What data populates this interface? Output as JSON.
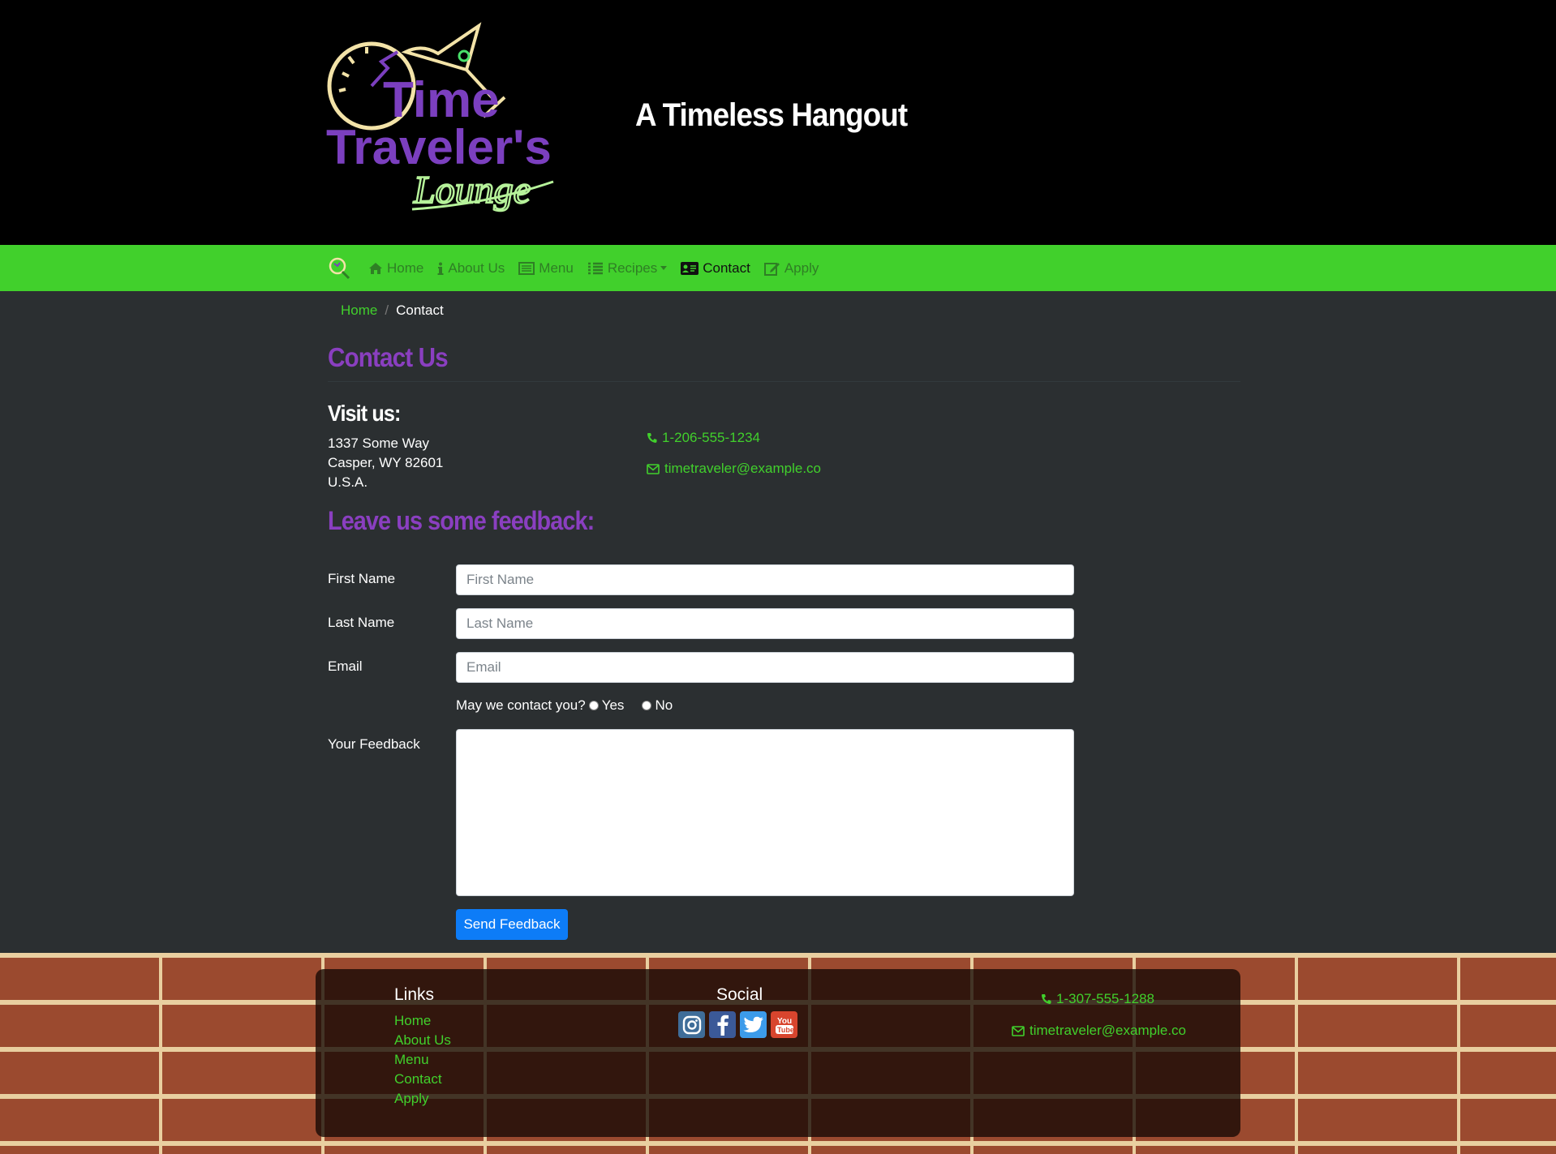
{
  "header": {
    "logo_text": "Time Traveler's Lounge",
    "tagline": "A Timeless Hangout"
  },
  "nav": {
    "items": [
      {
        "label": "Home",
        "icon": "home-icon"
      },
      {
        "label": "About Us",
        "icon": "info-icon"
      },
      {
        "label": "Menu",
        "icon": "list-alt-icon"
      },
      {
        "label": "Recipes",
        "icon": "list-icon"
      },
      {
        "label": "Contact",
        "icon": "address-card-icon"
      },
      {
        "label": "Apply",
        "icon": "edit-icon"
      }
    ],
    "active": "Contact"
  },
  "breadcrumb": {
    "home": "Home",
    "separator": "/",
    "current": "Contact"
  },
  "page": {
    "title": "Contact Us",
    "visit_heading": "Visit us:",
    "address": [
      "1337 Some Way",
      "Casper, WY 82601",
      "U.S.A."
    ],
    "phone": "1-206-555-1234",
    "email": "timetraveler@example.co",
    "feedback_heading": "Leave us some feedback:"
  },
  "form": {
    "first_name_label": "First Name",
    "first_name_placeholder": "First Name",
    "last_name_label": "Last Name",
    "last_name_placeholder": "Last Name",
    "email_label": "Email",
    "email_placeholder": "Email",
    "contact_question": "May we contact you?",
    "yes_label": "Yes",
    "no_label": "No",
    "feedback_label": "Your Feedback",
    "submit_label": "Send Feedback"
  },
  "footer": {
    "links_heading": "Links",
    "links": [
      "Home",
      "About Us",
      "Menu",
      "Contact",
      "Apply"
    ],
    "social_heading": "Social",
    "social": [
      "instagram-icon",
      "facebook-icon",
      "twitter-icon",
      "youtube-icon"
    ],
    "phone": "1-307-555-1288",
    "email": "timetraveler@example.co"
  },
  "colors": {
    "accent_green": "#41d02c",
    "heading_purple": "#8a3fc0",
    "button_blue": "#0d7cf7",
    "page_bg": "#2b2f31"
  }
}
